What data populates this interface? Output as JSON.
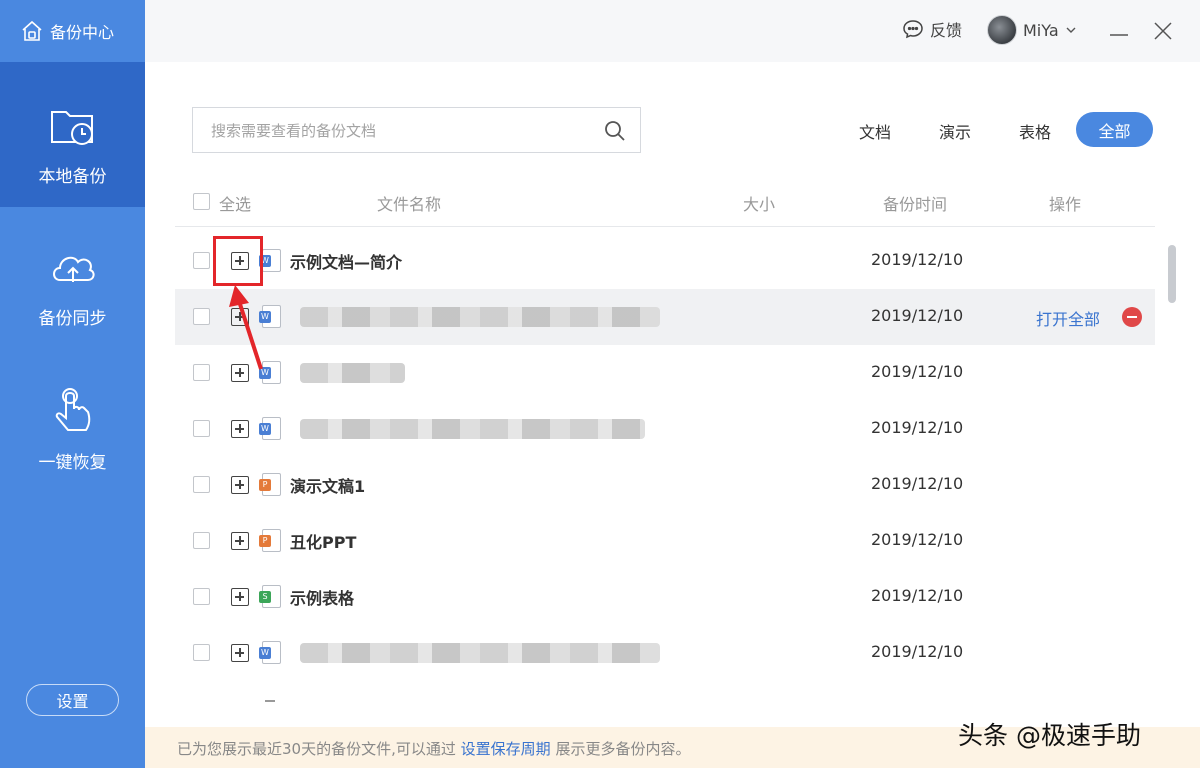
{
  "app": {
    "title": "备份中心"
  },
  "sidebar": {
    "items": [
      {
        "label": "本地备份",
        "icon": "folder-clock-icon",
        "active": true
      },
      {
        "label": "备份同步",
        "icon": "cloud-upload-icon",
        "active": false
      },
      {
        "label": "一键恢复",
        "icon": "hand-pointer-icon",
        "active": false
      }
    ],
    "settings_label": "设置"
  },
  "topbar": {
    "feedback_label": "反馈",
    "user_name": "MiYa"
  },
  "search": {
    "placeholder": "搜索需要查看的备份文档"
  },
  "filters": {
    "doc": "文档",
    "ppt": "演示",
    "xls": "表格",
    "all": "全部",
    "selected": "全部"
  },
  "table": {
    "select_all": "全选",
    "columns": {
      "name": "文件名称",
      "size": "大小",
      "time": "备份时间",
      "action": "操作"
    },
    "rows": [
      {
        "type": "doc",
        "name": "示例文档—简介",
        "date": "2019/12/10"
      },
      {
        "type": "doc",
        "name": "",
        "date": "2019/12/10",
        "hover": true,
        "action_label": "打开全部"
      },
      {
        "type": "doc",
        "name": "",
        "date": "2019/12/10"
      },
      {
        "type": "doc",
        "name": "",
        "date": "2019/12/10"
      },
      {
        "type": "ppt",
        "name": "演示文稿1",
        "date": "2019/12/10"
      },
      {
        "type": "ppt",
        "name": "丑化PPT",
        "date": "2019/12/10"
      },
      {
        "type": "xls",
        "name": "示例表格",
        "date": "2019/12/10"
      },
      {
        "type": "doc",
        "name": "",
        "date": "2019/12/10"
      }
    ]
  },
  "footer": {
    "text_before": "已为您展示最近30天的备份文件,可以通过",
    "link": "设置保存周期",
    "text_after": "展示更多备份内容。"
  },
  "watermark": "头条 @极速手助",
  "colors": {
    "sidebar": "#4a88e0",
    "sidebar_active": "#2f68c7",
    "accent": "#4a88e0",
    "link": "#3a74cf",
    "annotation": "#e3262a"
  }
}
